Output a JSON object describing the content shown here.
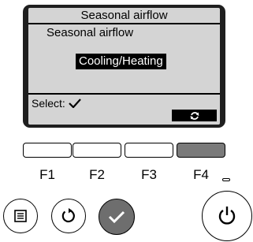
{
  "lcd": {
    "title": "Seasonal airflow",
    "subtitle": "Seasonal airflow",
    "selected_value": "Cooling/Heating",
    "select_label": "Select:",
    "select_icon": "check-icon",
    "softkey_icon": "cycle-arrows-icon"
  },
  "function_keys": [
    {
      "label": "F1",
      "active": false
    },
    {
      "label": "F2",
      "active": false
    },
    {
      "label": "F3",
      "active": false
    },
    {
      "label": "F4",
      "active": true
    }
  ],
  "buttons": {
    "menu_icon": "menu-icon",
    "return_icon": "return-icon",
    "confirm_icon": "check-icon",
    "power_icon": "power-icon"
  },
  "colors": {
    "screen_bezel": "#1f1f1f",
    "lcd_background": "#d4d4d4",
    "active_key": "#7a7a7a",
    "confirm_button": "#6e6e6e"
  }
}
